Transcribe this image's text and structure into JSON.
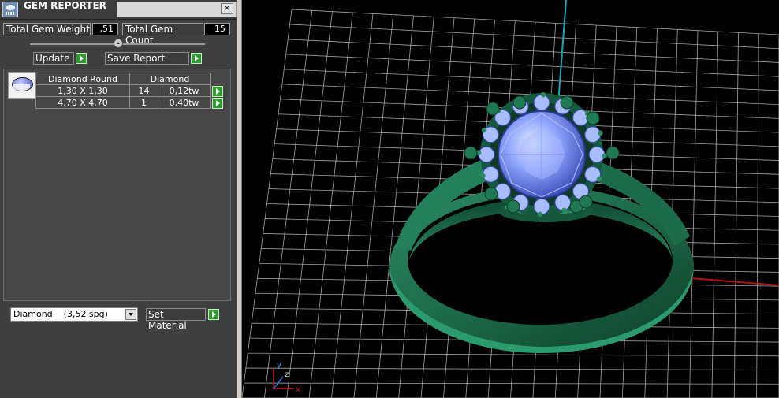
{
  "window": {
    "title": "GEM REPORTER",
    "close_glyph": "✕"
  },
  "stats": {
    "weight_label": "Total Gem Weight",
    "weight_value": ",51",
    "count_label": "Total Gem Count",
    "count_value": "15"
  },
  "actions": {
    "update_label": "Update",
    "save_label": "Save Report"
  },
  "table": {
    "headers": [
      "Diamond Round",
      "Diamond"
    ],
    "rows": [
      {
        "size": "1,30 X 1,30",
        "count": "14",
        "weight": "0,12tw"
      },
      {
        "size": "4,70 X 4,70",
        "count": "1",
        "weight": "0,40tw"
      }
    ]
  },
  "material": {
    "selected": "Diamond    (3,52 spg)",
    "set_label": "Set Material"
  },
  "viewport": {
    "axis_labels": {
      "x": "x",
      "y": "y",
      "z": "z"
    },
    "colors": {
      "grid": "#bfbfbf",
      "metal": "#1f6b4c",
      "stone": "#8fa6ff",
      "x_axis": "#b31212",
      "z_axis": "#18a6b4"
    }
  },
  "icons": [
    "app-icon",
    "close-icon",
    "slider-thumb-icon",
    "go-arrow-icon",
    "gem-thumbnail",
    "dropdown-arrow-icon"
  ]
}
